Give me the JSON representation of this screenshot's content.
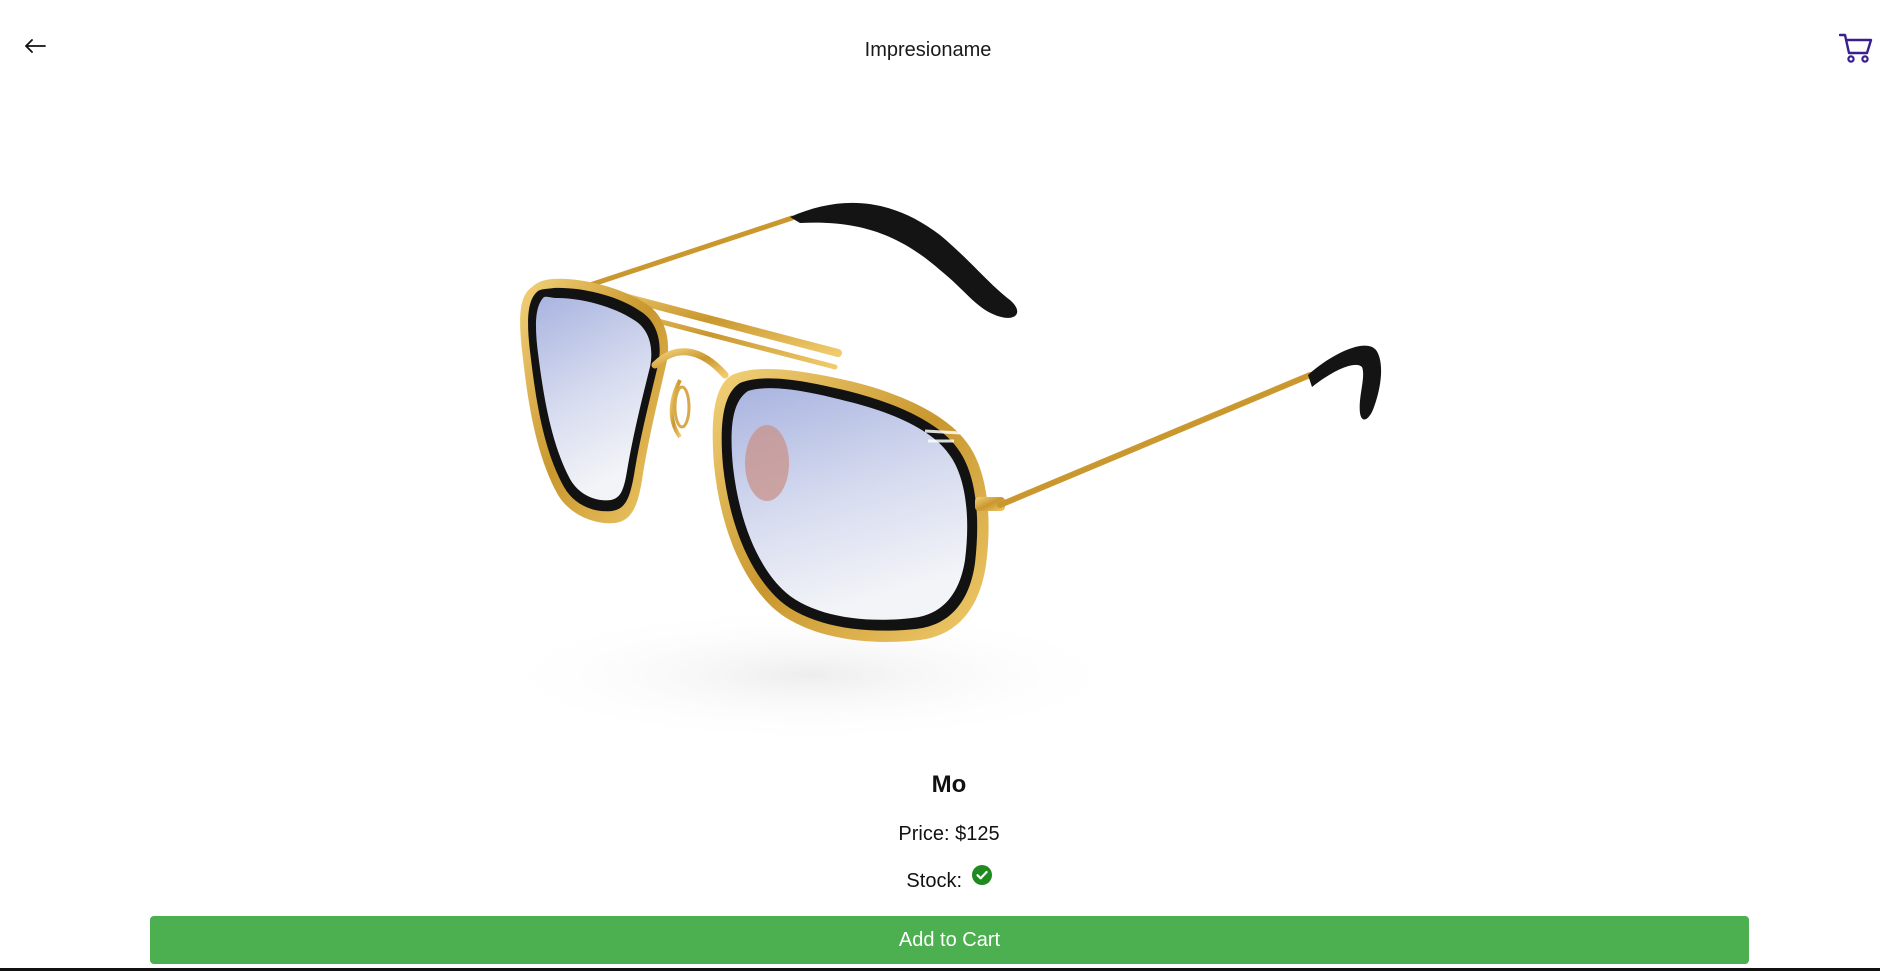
{
  "header": {
    "title": "Impresioname",
    "back_icon": "arrow-left-icon",
    "cart_icon": "shopping-cart-icon"
  },
  "product": {
    "image_alt": "sunglasses",
    "name": "Mo",
    "price_label": "Price:",
    "price_value": "$125",
    "stock_label": "Stock:",
    "stock_icon": "check-circle-icon",
    "in_stock": true
  },
  "actions": {
    "add_to_cart_label": "Add to Cart"
  },
  "colors": {
    "accent": "#4caf50",
    "cart_icon": "#3a1f8f",
    "stock_ok": "#1f8a1f"
  }
}
